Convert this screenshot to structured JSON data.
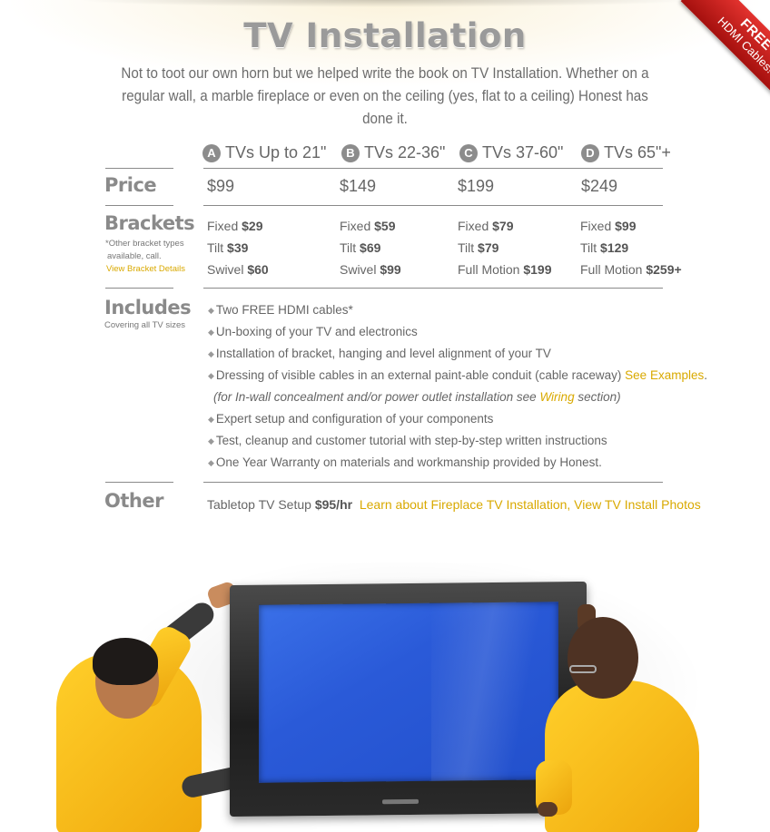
{
  "ribbon": {
    "line1": "FREE",
    "line2": "HDMI Cables!"
  },
  "page_title": "TV Installation",
  "intro": "Not to toot our own horn but we helped write the book on TV Installation. Whether on a regular wall, a marble fireplace or even on the ceiling (yes, flat to a ceiling) Honest has done it.",
  "columns": [
    {
      "badge": "A",
      "label": "TVs Up to 21\""
    },
    {
      "badge": "B",
      "label": "TVs 22-36\""
    },
    {
      "badge": "C",
      "label": "TVs 37-60\""
    },
    {
      "badge": "D",
      "label": "TVs 65\"+"
    }
  ],
  "price": {
    "title": "Price",
    "values": [
      "$99",
      "$149",
      "$199",
      "$249"
    ]
  },
  "brackets": {
    "title": "Brackets",
    "note_line1": "*Other bracket types",
    "note_line2": "available, call.",
    "details_link": "View Bracket Details",
    "rows": [
      [
        {
          "type": "Fixed",
          "price": "$29"
        },
        {
          "type": "Fixed",
          "price": "$59"
        },
        {
          "type": "Fixed",
          "price": "$79"
        },
        {
          "type": "Fixed",
          "price": "$99"
        }
      ],
      [
        {
          "type": "Tilt",
          "price": "$39"
        },
        {
          "type": "Tilt",
          "price": "$69"
        },
        {
          "type": "Tilt",
          "price": "$79"
        },
        {
          "type": "Tilt",
          "price": "$129"
        }
      ],
      [
        {
          "type": "Swivel",
          "price": "$60"
        },
        {
          "type": "Swivel",
          "price": "$99"
        },
        {
          "type": "Full Motion",
          "price": "$199"
        },
        {
          "type": "Full Motion",
          "price": "$259+"
        }
      ]
    ]
  },
  "includes": {
    "title": "Includes",
    "note": "Covering all TV sizes",
    "items": [
      "Two FREE HDMI cables*",
      "Un-boxing of your TV and electronics",
      "Installation of bracket, hanging and level alignment of your TV",
      "Dressing of visible cables in an external paint-able conduit (cable raceway)",
      "Expert setup and configuration of your components",
      "Test, cleanup and customer tutorial with step-by-step written instructions",
      "One Year Warranty on materials and workmanship provided by Honest."
    ],
    "see_examples_link": "See Examples",
    "see_examples_period": ".",
    "note_before": "(for In-wall concealment and/or power outlet installation see ",
    "wiring_link": "Wiring",
    "note_after": " section)"
  },
  "other": {
    "title": "Other",
    "tabletop_label": "Tabletop TV Setup ",
    "tabletop_price": "$95/hr",
    "links": "Learn about Fireplace TV Installation, View TV Install Photos"
  },
  "colors": {
    "link": "#d9a900",
    "ribbon": "#c8201c",
    "jacket": "#f7b81a",
    "screen": "#2f63df"
  }
}
